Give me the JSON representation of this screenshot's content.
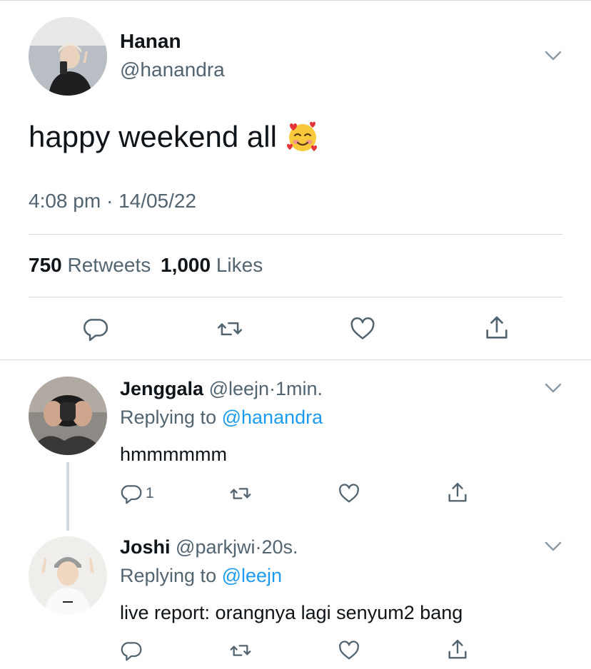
{
  "tweet": {
    "author_name": "Hanan",
    "author_handle": "@hanandra",
    "text": "happy weekend all",
    "emoji": "smiling-face-with-hearts",
    "time": "4:08 pm",
    "separator": "·",
    "date": "14/05/22",
    "retweets_count": "750",
    "retweets_label": "Retweets",
    "likes_count": "1,000",
    "likes_label": "Likes"
  },
  "replies": [
    {
      "name": "Jenggala",
      "handle": "@leejn",
      "separator": "·",
      "time": "1min.",
      "replying_label": "Replying to",
      "replying_to": "@hanandra",
      "text": "hmmmmmm",
      "reply_count": "1"
    },
    {
      "name": "Joshi",
      "handle": "@parkjwi",
      "separator": "·",
      "time": "20s.",
      "replying_label": "Replying to",
      "replying_to": "@leejn",
      "text": "live report: orangnya lagi senyum2 bang"
    }
  ],
  "colors": {
    "accent": "#1d9bf0",
    "secondary_text": "#536471",
    "primary_text": "#0f1419",
    "divider": "#cfd9de"
  },
  "icons": [
    "reply-icon",
    "retweet-icon",
    "like-icon",
    "share-icon",
    "chevron-down-icon"
  ]
}
